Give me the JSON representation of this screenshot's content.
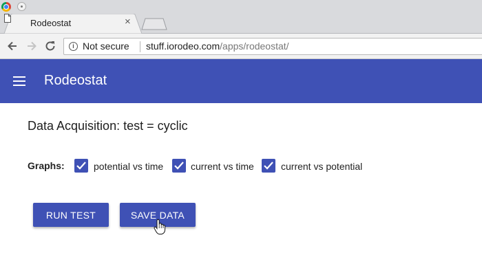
{
  "browser": {
    "tab": {
      "title": "Rodeostat",
      "close_glyph": "×",
      "favicon": "page-icon"
    },
    "address_bar": {
      "security_label": "Not secure",
      "url_host": "stuff.iorodeo.com",
      "url_path": "/apps/rodeostat/"
    }
  },
  "app": {
    "title": "Rodeostat",
    "page_title": "Data Acquisition: test = cyclic",
    "graphs": {
      "label": "Graphs:",
      "options": [
        {
          "label": "potential vs time",
          "checked": true
        },
        {
          "label": "current vs time",
          "checked": true
        },
        {
          "label": "current vs potential",
          "checked": true
        }
      ]
    },
    "buttons": {
      "run_test": "RUN TEST",
      "save_data": "SAVE DATA"
    }
  },
  "colors": {
    "primary": "#3f51b5",
    "chrome_bg": "#d9dadd",
    "toolbar_bg": "#f2f2f2"
  }
}
